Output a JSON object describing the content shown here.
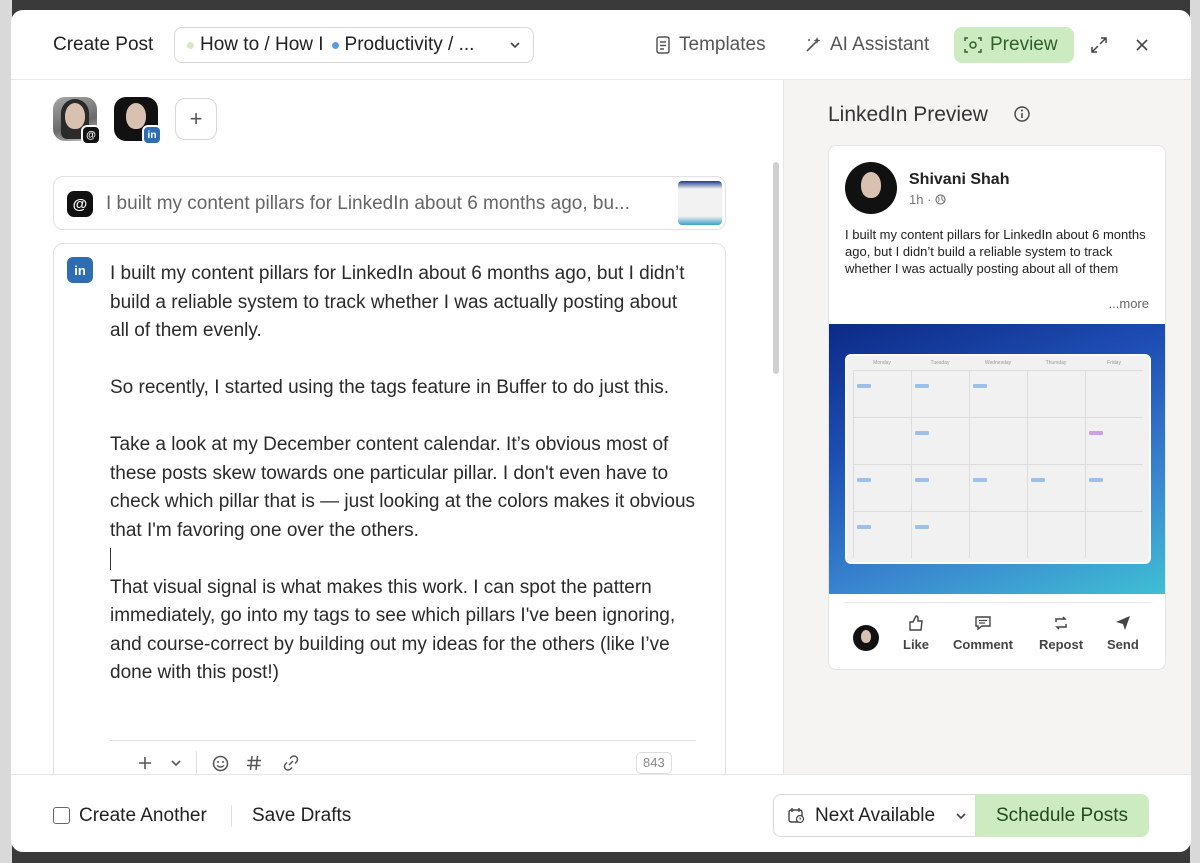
{
  "header": {
    "title": "Create Post",
    "tags_select": {
      "tag1": "How to / How I",
      "tag2": "Productivity / ..."
    },
    "templates_label": "Templates",
    "ai_assistant_label": "AI Assistant",
    "preview_label": "Preview"
  },
  "editor": {
    "threads_preview_text": "I built my content pillars for LinkedIn about 6 months ago, bu...",
    "post_paragraphs": [
      "I built my content pillars for LinkedIn about 6 months ago, but I didn’t build a reliable system to track whether I was actually posting about all of them evenly.",
      "So recently, I started using the tags feature in Buffer to do just this.",
      "Take a look at my December content calendar. It’s obvious most of these posts skew towards one particular pillar. I don't even have to check which pillar that is — just looking at the colors makes it obvious that I'm favoring one over the others.",
      "That visual signal is what makes this work. I can spot the pattern immediately, go into my tags to see which pillars I've been ignoring, and course-correct by building out my ideas for the others (like I’ve done with this post!)"
    ],
    "char_count": "843",
    "add_account_label": "+"
  },
  "preview": {
    "title": "LinkedIn Preview",
    "author_name": "Shivani Shah",
    "author_meta": "1h ·",
    "post_excerpt": "I built my content pillars for LinkedIn about 6 months ago, but I didn’t build a reliable system to track whether I was actually posting about all of them",
    "more_label": "...more",
    "calendar_days": [
      "Monday",
      "Tuesday",
      "Wednesday",
      "Thursday",
      "Friday"
    ],
    "actions": {
      "like": "Like",
      "comment": "Comment",
      "repost": "Repost",
      "send": "Send"
    }
  },
  "footer": {
    "create_another_label": "Create Another",
    "save_drafts_label": "Save Drafts",
    "next_available_label": "Next Available",
    "schedule_label": "Schedule Posts"
  },
  "colors": {
    "preview_active_bg": "#cdebc1",
    "linkedin_blue": "#2f6db3",
    "threads_black": "#111111"
  }
}
